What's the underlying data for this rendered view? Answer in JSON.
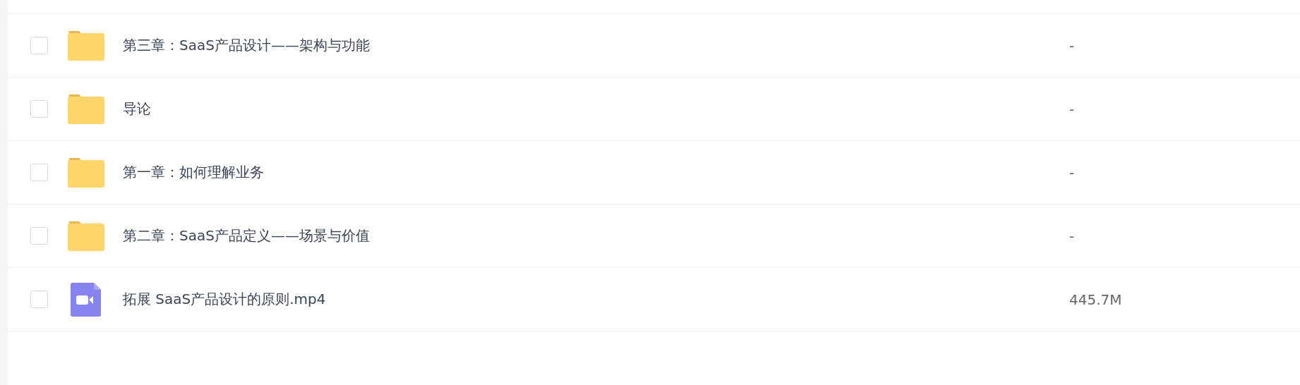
{
  "files": [
    {
      "kind": "folder",
      "name": "第三章：SaaS产品设计——架构与功能",
      "size": "-",
      "checked": false
    },
    {
      "kind": "folder",
      "name": "导论",
      "size": "-",
      "checked": false
    },
    {
      "kind": "folder",
      "name": "第一章：如何理解业务",
      "size": "-",
      "checked": false
    },
    {
      "kind": "folder",
      "name": "第二章：SaaS产品定义——场景与价值",
      "size": "-",
      "checked": false
    },
    {
      "kind": "video",
      "name": "拓展 SaaS产品设计的原则.mp4",
      "size": "445.7M",
      "checked": false
    }
  ]
}
